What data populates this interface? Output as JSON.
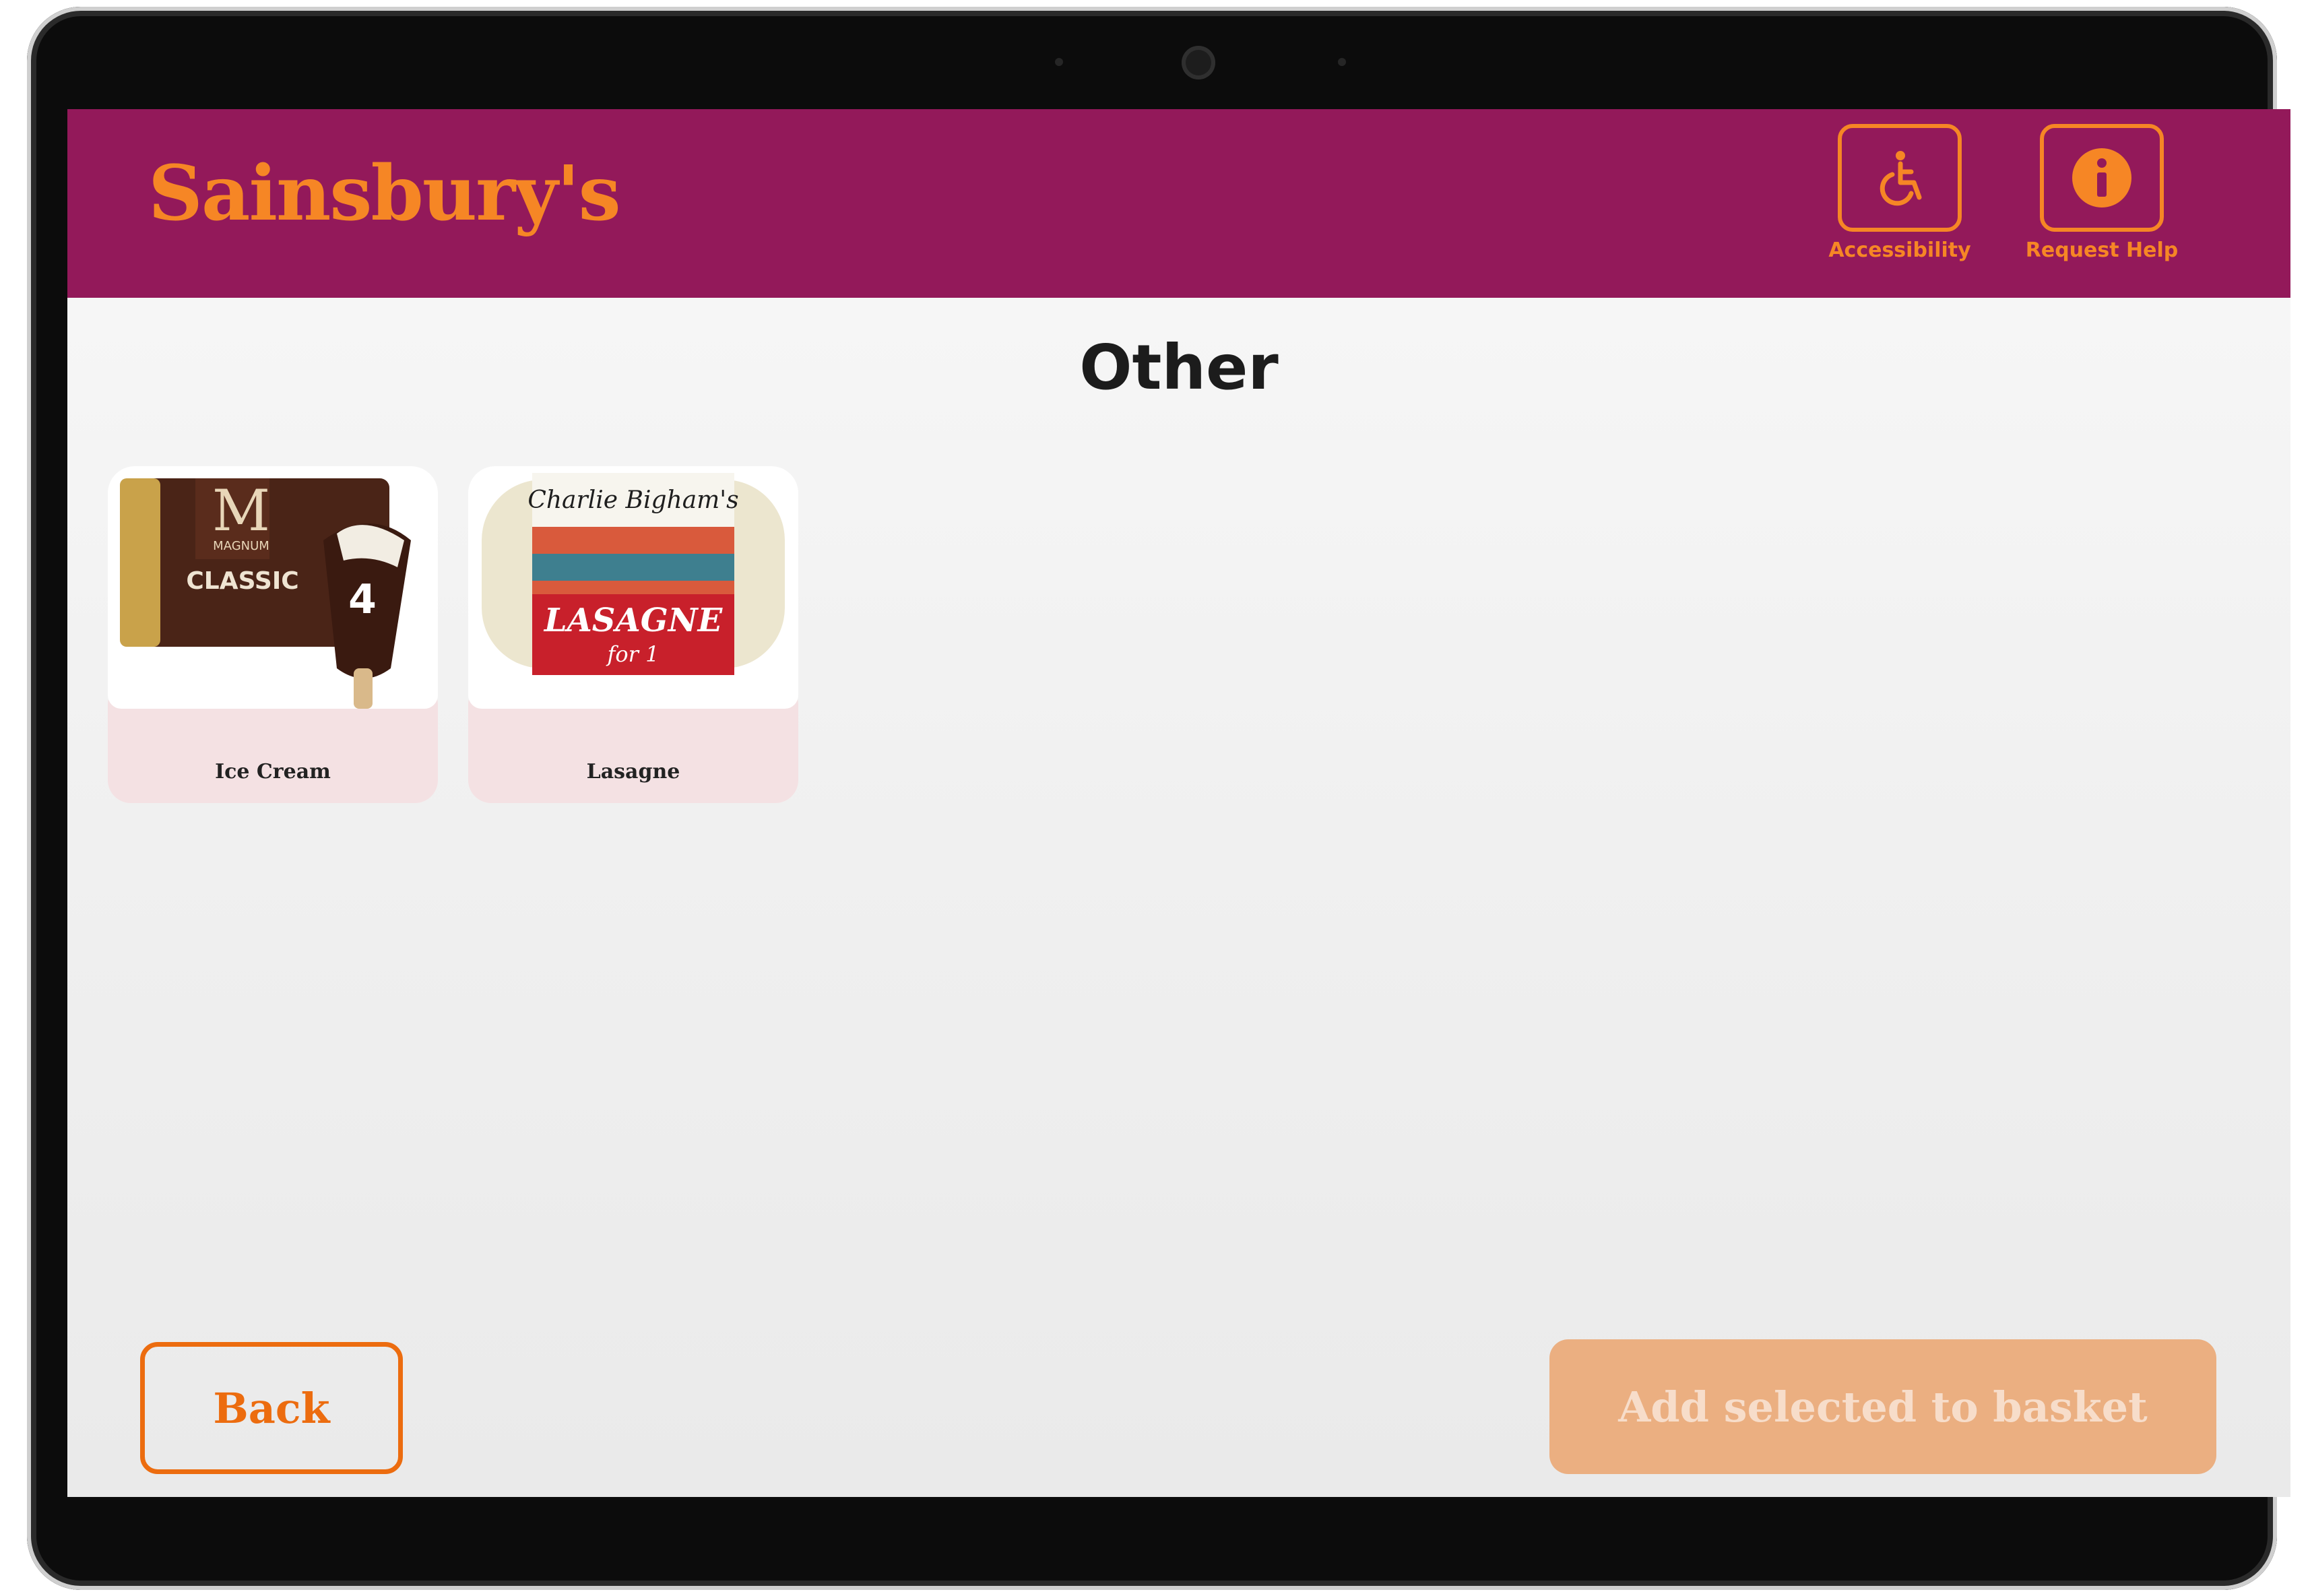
{
  "header": {
    "brand": "Sainsbury's",
    "brand_color": "#f68625",
    "background": "#93195a",
    "buttons": [
      {
        "label": "Accessibility",
        "icon": "wheelchair-icon"
      },
      {
        "label": "Request Help",
        "icon": "info-icon"
      }
    ]
  },
  "page": {
    "title": "Other"
  },
  "products": [
    {
      "name": "Ice Cream",
      "image_brand": "MAGNUM",
      "image_variant": "CLASSIC",
      "image_count": "4"
    },
    {
      "name": "Lasagne",
      "image_brand": "Charlie Bigham's",
      "image_product": "LASAGNE",
      "image_sub": "for 1"
    }
  ],
  "footer": {
    "back_label": "Back",
    "add_label": "Add selected to basket",
    "add_state": "disabled"
  }
}
